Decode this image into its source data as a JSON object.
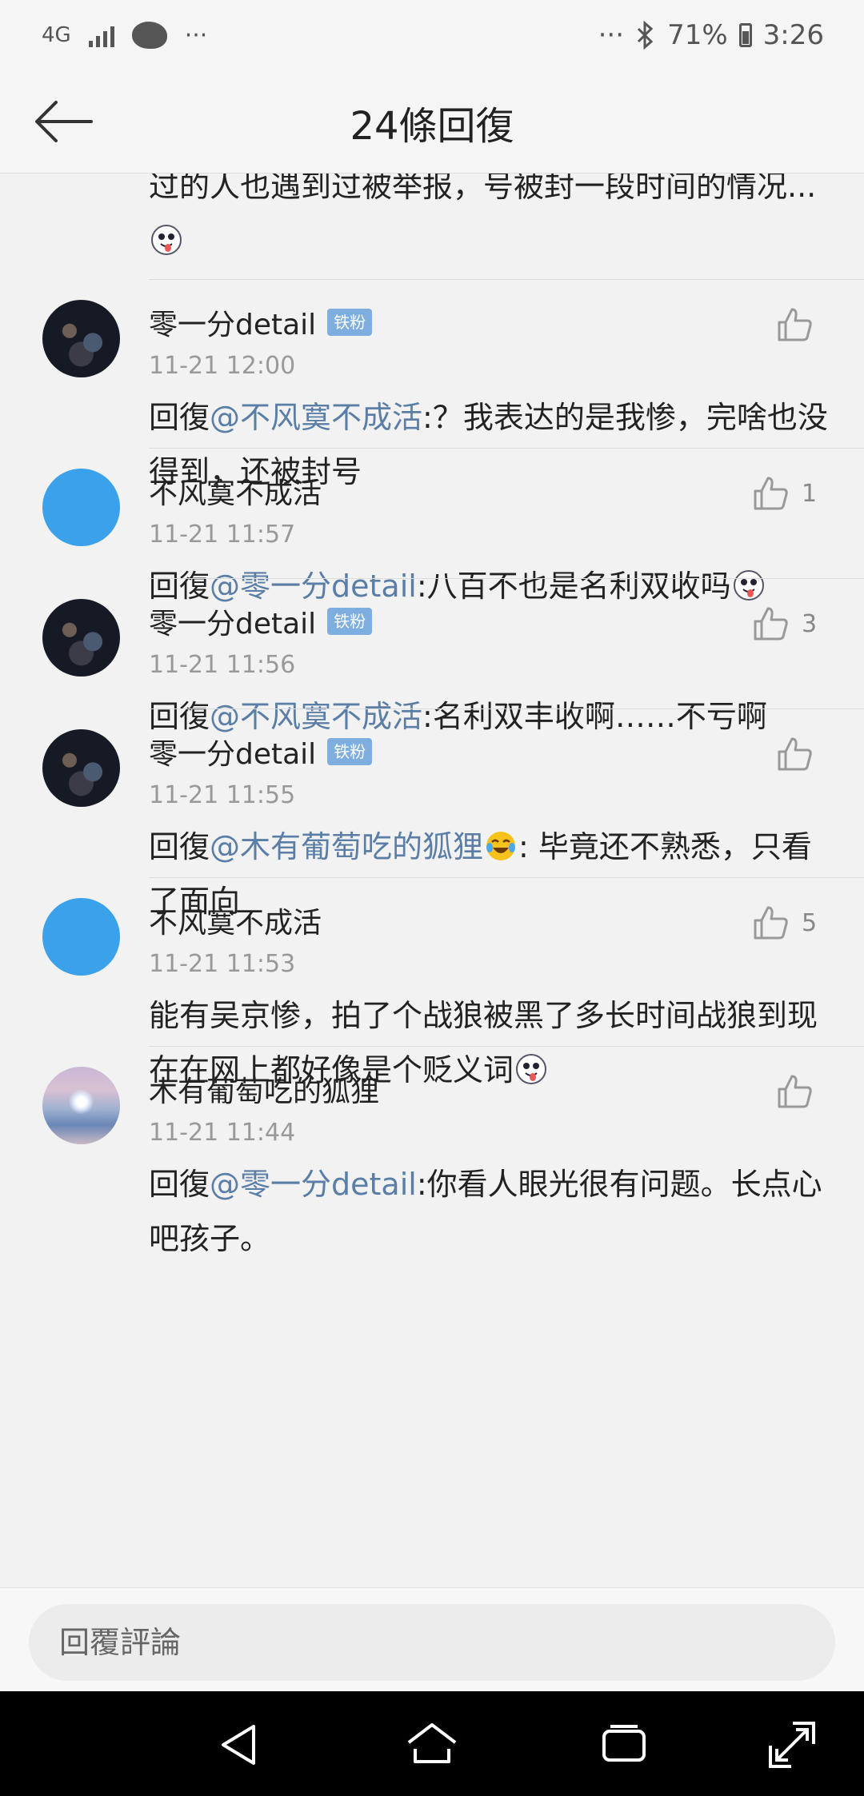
{
  "status_bar": {
    "network": "4G",
    "dots_left": "···",
    "dots_right": "···",
    "battery": "71%",
    "time": "3:26"
  },
  "header": {
    "title": "24條回復"
  },
  "partial_comment": {
    "text": "过的人也遇到过被举报，号被封一段时间的情况..."
  },
  "comments": [
    {
      "name": "零一分detail",
      "badge": "铁粉",
      "time": "11-21 12:00",
      "likes": "",
      "prefix": "回復",
      "mention": "@不风寞不成活",
      "text": ":？我表达的是我惨，完啥也没得到，还被封号",
      "avatar": "dark"
    },
    {
      "name": "不风寞不成活",
      "badge": "",
      "time": "11-21 11:57",
      "likes": "1",
      "prefix": "回復",
      "mention": "@零一分detail",
      "text": ":八百不也是名利双收吗",
      "avatar": "blue"
    },
    {
      "name": "零一分detail",
      "badge": "铁粉",
      "time": "11-21 11:56",
      "likes": "3",
      "prefix": "回復",
      "mention": "@不风寞不成活",
      "text": ":名利双丰收啊……不亏啊",
      "avatar": "dark"
    },
    {
      "name": "零一分detail",
      "badge": "铁粉",
      "time": "11-21 11:55",
      "likes": "",
      "prefix": "回復",
      "mention": "@木有葡萄吃的狐狸",
      "text": ": 毕竟还不熟悉，只看了面向",
      "avatar": "dark"
    },
    {
      "name": "不风寞不成活",
      "badge": "",
      "time": "11-21 11:53",
      "likes": "5",
      "prefix": "",
      "mention": "",
      "text": "能有吴京惨，拍了个战狼被黑了多长时间战狼到现在在网上都好像是个贬义词",
      "avatar": "blue"
    },
    {
      "name": "木有葡萄吃的狐狸",
      "badge": "",
      "time": "11-21 11:44",
      "likes": "",
      "prefix": "回復",
      "mention": "@零一分detail",
      "text": ":你看人眼光很有问题。长点心吧孩子。",
      "avatar": "sky"
    }
  ],
  "reply_bar": {
    "placeholder": "回覆評論"
  },
  "icons": {
    "back": "arrow-left-icon",
    "like": "thumbs-up-icon",
    "emoji": "tongue-face-emoji",
    "laugh": "laughing-crying-emoji"
  }
}
